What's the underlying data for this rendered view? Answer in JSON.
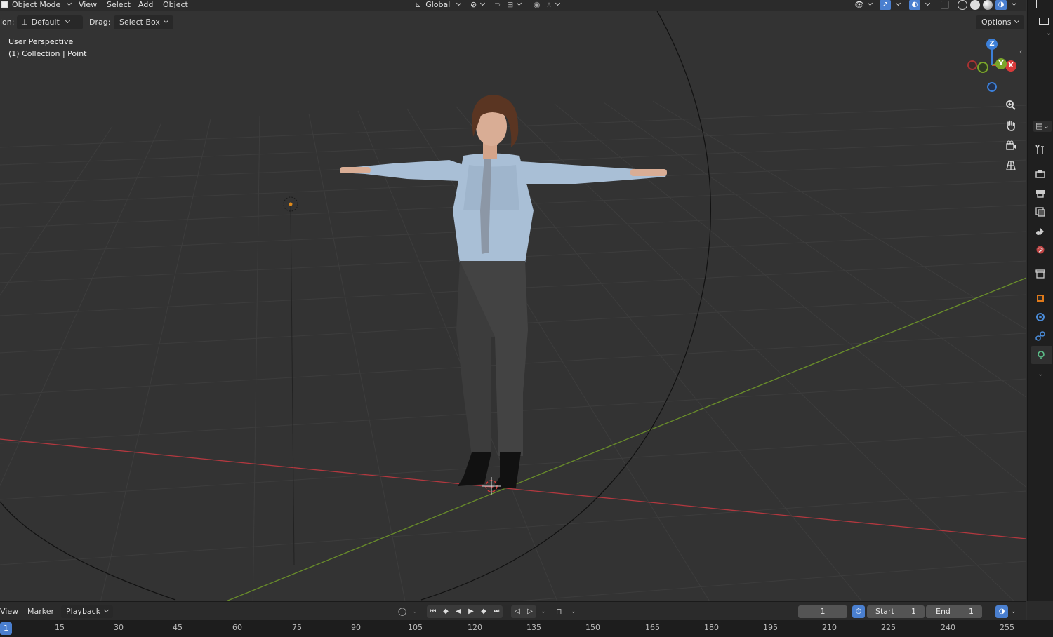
{
  "header": {
    "mode": "Object Mode",
    "menus": [
      "View",
      "Select",
      "Add",
      "Object"
    ],
    "orientation": "Global"
  },
  "toolbar": {
    "orientation_label": "ion:",
    "orientation_value": "Default",
    "drag_label": "Drag:",
    "drag_value": "Select Box",
    "options": "Options"
  },
  "viewport": {
    "perspective": "User Perspective",
    "collection": "(1) Collection | Point"
  },
  "gizmo": {
    "z": "Z",
    "y": "Y",
    "x": "X"
  },
  "nav_icons": [
    "zoom-icon",
    "hand-pan-icon",
    "camera-view-icon",
    "grid-ortho-icon"
  ],
  "prop_icons": [
    "tool-icon",
    "render-icon",
    "output-icon",
    "view-layer-icon",
    "scene-icon",
    "world-icon",
    "collection-icon",
    "object-icon",
    "modifier-icon",
    "physics-icon",
    "light-data-icon"
  ],
  "timeline": {
    "menus": [
      "View",
      "Marker",
      "Playback"
    ],
    "current_frame": "1",
    "start_label": "Start",
    "start_value": "1",
    "end_label": "End",
    "end_value": "1",
    "ticks": [
      "1",
      "15",
      "30",
      "45",
      "60",
      "75",
      "90",
      "105",
      "120",
      "135",
      "150",
      "165",
      "180",
      "195",
      "210",
      "225",
      "240",
      "255"
    ]
  },
  "colors": {
    "bg": "#303030",
    "header": "#2b2b2b",
    "x_axis": "#d83a3a",
    "y_axis": "#7aa52a",
    "z_gizmo": "#3c7fd8",
    "accent": "#4a7fcf"
  }
}
